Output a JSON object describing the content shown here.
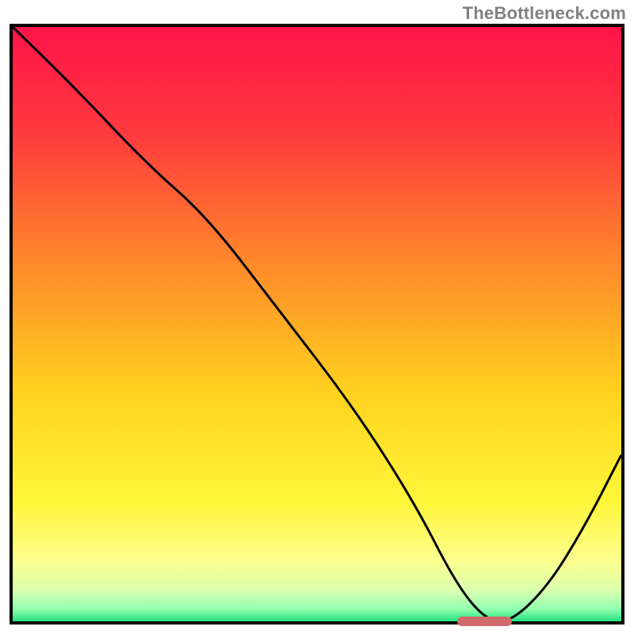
{
  "watermark": "TheBottleneck.com",
  "chart_data": {
    "type": "line",
    "title": "",
    "xlabel": "",
    "ylabel": "",
    "xlim": [
      0,
      100
    ],
    "ylim": [
      0,
      100
    ],
    "background_gradient": {
      "stops": [
        {
          "pct": 0,
          "color": "#ff1449"
        },
        {
          "pct": 18,
          "color": "#ff3a3e"
        },
        {
          "pct": 40,
          "color": "#ff8a2a"
        },
        {
          "pct": 62,
          "color": "#ffd31f"
        },
        {
          "pct": 80,
          "color": "#fff63a"
        },
        {
          "pct": 90,
          "color": "#fcff90"
        },
        {
          "pct": 95,
          "color": "#d7ffb0"
        },
        {
          "pct": 98,
          "color": "#8effae"
        },
        {
          "pct": 100,
          "color": "#22e27f"
        }
      ]
    },
    "series": [
      {
        "name": "bottleneck-curve",
        "x": [
          0,
          10,
          22,
          32,
          44,
          56,
          66,
          73,
          78,
          82,
          88,
          94,
          100
        ],
        "y": [
          100,
          90,
          77,
          68,
          52,
          36,
          20,
          6,
          0,
          0,
          6,
          16,
          28
        ]
      }
    ],
    "marker": {
      "x_start": 73,
      "x_end": 82,
      "y": 0,
      "color": "#cf6a6f"
    }
  }
}
